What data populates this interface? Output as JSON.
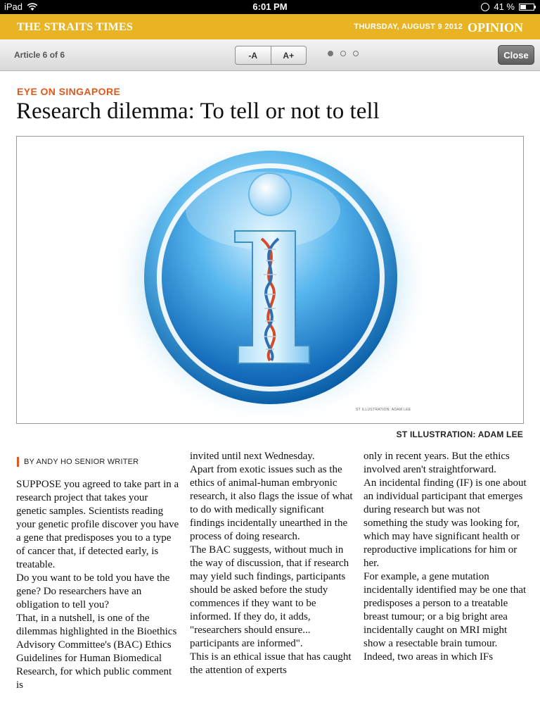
{
  "status_bar": {
    "device": "iPad",
    "time": "6:01 PM",
    "battery": "41 %"
  },
  "masthead": {
    "brand": "THE STRAITS TIMES",
    "date": "THURSDAY, AUGUST 9 2012",
    "section": "OPINION"
  },
  "toolbar": {
    "article_count": "Article 6 of 6",
    "font_smaller": "-A",
    "font_larger": "A+",
    "close": "Close"
  },
  "article": {
    "kicker": "EYE ON SINGAPORE",
    "headline": "Research dilemma: To tell or not to tell",
    "figure_credit_inset": "ST ILLUSTRATION: ADAM LEE",
    "figure_credit": "ST ILLUSTRATION: ADAM LEE",
    "byline": "BY ANDY HO SENIOR WRITER",
    "col1": [
      "SUPPOSE you agreed to take part in a research project that takes your genetic samples. Scientists reading your genetic profile discover you have a gene that predisposes you to a type of cancer that, if detected early, is treatable.",
      " Do you want to be told you have the gene? Do researchers have an obligation to tell you?",
      " That, in a nutshell, is one of the dilemmas highlighted in the Bioethics Advisory Committee's (BAC) Ethics Guidelines for Human Biomedical Research, for which public comment is"
    ],
    "col2": [
      "invited until next Wednesday.",
      " Apart from exotic issues such as the ethics of animal-human embryonic research, it also flags the issue of what to do with medically significant findings incidentally unearthed in the process of doing research.",
      " The BAC suggests, without much in the way of discussion, that if research may yield such findings, participants should be asked before the study commences if they want to be informed. If they do, it adds, \"researchers should ensure... participants are informed\".",
      " This is an ethical issue that has caught the attention of experts"
    ],
    "col3": [
      "only in recent years. But the ethics involved aren't straightforward.",
      " An incidental finding (IF) is one about an individual participant that emerges during research but was not something the study was looking for, which may have significant health or reproductive implications for him or her.",
      " For example, a gene mutation incidentally identified may be one that predisposes a person to a treatable breast tumour; or a big bright area incidentally caught on MRI might show a resectable brain tumour.",
      " Indeed, two areas in which IFs"
    ]
  },
  "colors": {
    "masthead": "#e8b423",
    "accent": "#e0581b"
  },
  "icons": [
    "wifi-icon",
    "lock-icon",
    "battery-icon",
    "info-dna-icon"
  ]
}
